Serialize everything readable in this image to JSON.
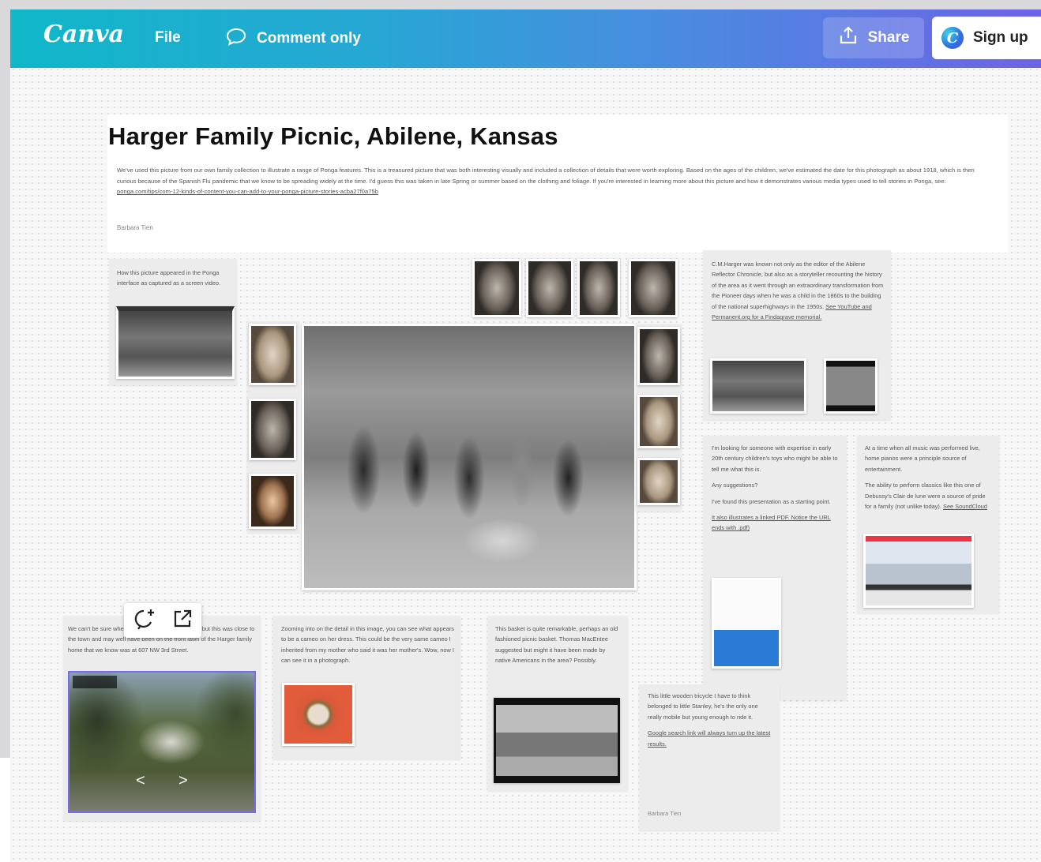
{
  "header": {
    "logo": "Canva",
    "file_label": "File",
    "comment_label": "Comment only",
    "share_label": "Share",
    "badge_letter": "C",
    "signup_label": "Sign up"
  },
  "story": {
    "title": "Harger Family Picnic, Abilene, Kansas",
    "description": "We've used this picture from our own family collection to illustrate a range of Ponga features. This is a treasured picture that was both interesting visually and included a collection of details that were worth exploring. Based on the ages of the children, we've estimated the date for this photograph as about 1918, which is then curious because of the Spanish Flu pandemic that we know to be spreading widely at the time. I'd guess this was taken in late Spring or summer based on the clothing and foliage. If you're interested in learning more about this picture and how it demonstrates various media types used to tell stories in Ponga, see:",
    "description_link": "ponga.com/tips/com-12-kinds-of-content-you-can-add-to-your-ponga-picture-stories-acba27f0a75b",
    "author": "Barbara Tien"
  },
  "captions": {
    "left1": "",
    "left2": "",
    "top1": "",
    "top2": "",
    "top3": "",
    "top4": "",
    "right1": "",
    "right2": "",
    "right3": ""
  },
  "notes": {
    "screen_video": "How this picture appeared in the Ponga interface as captured as a screen video.",
    "harger": "C.M.Harger was known not only as the editor of the Abilene Reflector Chronicle, but also as a storyteller recounting the history of the area as it went through an extraordinary transformation from the Pioneer days when he was a child in the 1860s to the building of the national superhighways in the 1950s.",
    "harger_link": "See YouTube and Permanent.org for a Findagrave memorial.",
    "toys_p1": "I'm looking for someone with expertise in early 20th century children's toys who might be able to tell me what this is.",
    "toys_p2": "Any suggestions?",
    "toys_p3": "I've found this presentation as a starting point.",
    "toys_p4": "It also illustrates a linked PDF. Notice the URL ends with .pdf)",
    "music_p1": "At a time when all music was performed live, home pianos were a principle source of entertainment.",
    "music_p2": "The ability to perform classics like this one of Debussy's Clair de lune were a source of pride for a family (not unlike today).",
    "music_link": "See SoundCloud",
    "house": "We can't be sure where this photograph was taken, but this was close to the town and may well have been on the front lawn of the Harger family home that we know was at 607 NW 3rd Street.",
    "cameo": "Zooming into on the detail in this image, you can see what appears to be a cameo on her dress. This could be the very same cameo I inherited from my mother who said it was her mother's. Wow, now I can see it in a photograph.",
    "basket": "This basket is quite remarkable, perhaps an old fashioned picnic basket. Thomas MacEntee suggested but might it have been made by native Americans in the area? Possibly.",
    "tricycle_p1": "This little wooden tricycle I have to think belonged to little Stanley, he's the only one really mobile but young enough to ride it.",
    "tricycle_p2": "Google search link will always turn up the latest results.",
    "tricycle_author": "Barbara Tien"
  },
  "icons": {
    "sv_left": "<",
    "sv_right": ">"
  }
}
